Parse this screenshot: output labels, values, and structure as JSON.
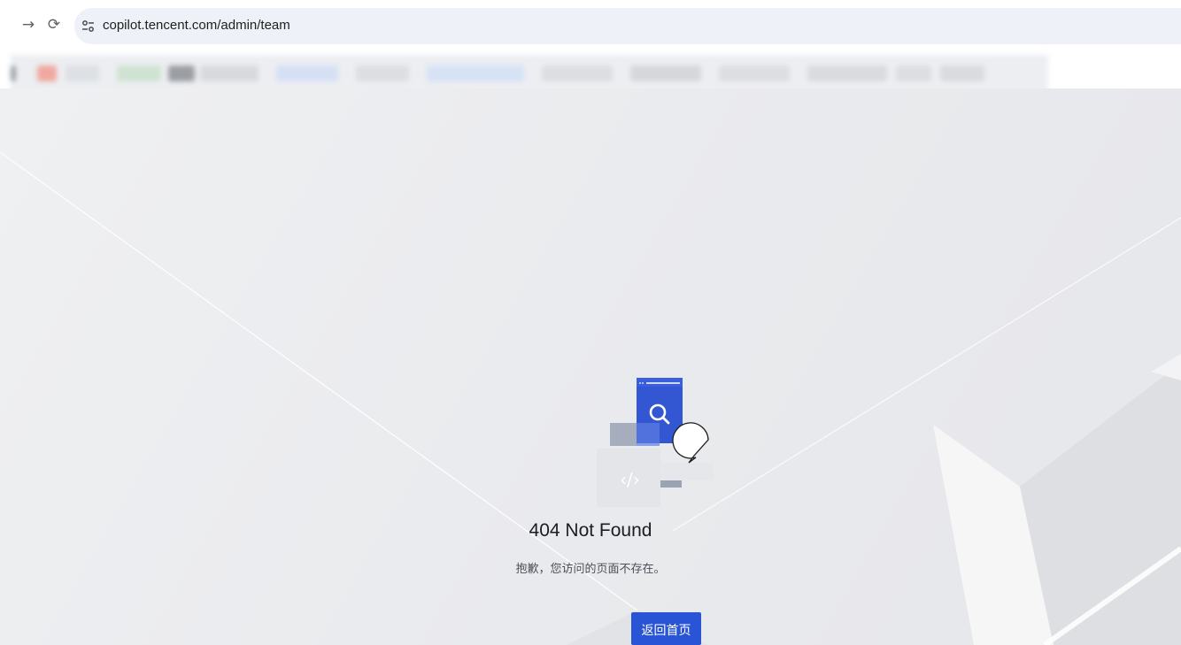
{
  "browser": {
    "forward_icon": "arrow-right-icon",
    "reload_icon": "reload-icon",
    "site_info_icon": "tune-icon",
    "url": "copilot.tencent.com/admin/team"
  },
  "bookmarks_bar": {
    "state": "blurred"
  },
  "page": {
    "title": "404 Not Found",
    "message": "抱歉，您访问的页面不存在。",
    "home_button_label": "返回首页",
    "illustration_icon": "search-illustration-icon"
  },
  "colors": {
    "accent": "#2a54d6",
    "background": "#eaebee",
    "illustration_blue": "#3356d2",
    "illustration_gray": "#9aa2b3"
  }
}
